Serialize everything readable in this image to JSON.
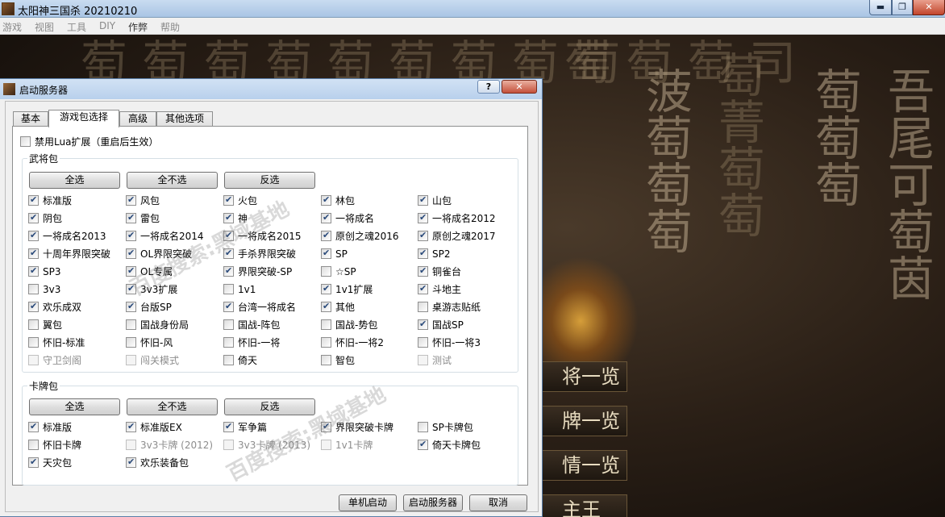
{
  "window": {
    "title": "太阳神三国杀 20210210",
    "controls": {
      "minimize": "▬",
      "maximize": "❐",
      "close": "✕"
    }
  },
  "menu": [
    "游戏",
    "视图",
    "工具",
    "DIY",
    "作弊",
    "帮助"
  ],
  "background": {
    "lobby_buttons": [
      "将一览",
      "牌一览",
      "情一览",
      "主王"
    ]
  },
  "dialog": {
    "title": "启动服务器",
    "help": "?",
    "close": "✕",
    "tabs": [
      "基本",
      "游戏包选择",
      "高级",
      "其他选项"
    ],
    "active_tab": "游戏包选择",
    "disable_lua": {
      "label": "禁用Lua扩展（重启后生效）",
      "checked": false
    },
    "general_group": {
      "title": "武将包",
      "buttons": [
        "全选",
        "全不选",
        "反选"
      ],
      "items": [
        {
          "label": "标准版",
          "checked": true,
          "disabled": false
        },
        {
          "label": "风包",
          "checked": true,
          "disabled": false
        },
        {
          "label": "火包",
          "checked": true,
          "disabled": false
        },
        {
          "label": "林包",
          "checked": true,
          "disabled": false
        },
        {
          "label": "山包",
          "checked": true,
          "disabled": false
        },
        {
          "label": "阴包",
          "checked": true,
          "disabled": false
        },
        {
          "label": "雷包",
          "checked": true,
          "disabled": false
        },
        {
          "label": "神",
          "checked": true,
          "disabled": false
        },
        {
          "label": "一将成名",
          "checked": true,
          "disabled": false
        },
        {
          "label": "一将成名2012",
          "checked": true,
          "disabled": false
        },
        {
          "label": "一将成名2013",
          "checked": true,
          "disabled": false
        },
        {
          "label": "一将成名2014",
          "checked": true,
          "disabled": false
        },
        {
          "label": "一将成名2015",
          "checked": true,
          "disabled": false
        },
        {
          "label": "原创之魂2016",
          "checked": true,
          "disabled": false
        },
        {
          "label": "原创之魂2017",
          "checked": true,
          "disabled": false
        },
        {
          "label": "十周年界限突破",
          "checked": true,
          "disabled": false
        },
        {
          "label": "OL界限突破",
          "checked": true,
          "disabled": false
        },
        {
          "label": "手杀界限突破",
          "checked": true,
          "disabled": false
        },
        {
          "label": "SP",
          "checked": true,
          "disabled": false
        },
        {
          "label": "SP2",
          "checked": true,
          "disabled": false
        },
        {
          "label": "SP3",
          "checked": true,
          "disabled": false
        },
        {
          "label": "OL专属",
          "checked": true,
          "disabled": false
        },
        {
          "label": "界限突破-SP",
          "checked": true,
          "disabled": false
        },
        {
          "label": "☆SP",
          "checked": false,
          "disabled": false
        },
        {
          "label": "铜雀台",
          "checked": true,
          "disabled": false
        },
        {
          "label": "3v3",
          "checked": false,
          "disabled": false
        },
        {
          "label": "3v3扩展",
          "checked": true,
          "disabled": false
        },
        {
          "label": "1v1",
          "checked": false,
          "disabled": false
        },
        {
          "label": "1v1扩展",
          "checked": true,
          "disabled": false
        },
        {
          "label": "斗地主",
          "checked": true,
          "disabled": false
        },
        {
          "label": "欢乐成双",
          "checked": true,
          "disabled": false
        },
        {
          "label": "台版SP",
          "checked": true,
          "disabled": false
        },
        {
          "label": "台湾一将成名",
          "checked": true,
          "disabled": false
        },
        {
          "label": "其他",
          "checked": true,
          "disabled": false
        },
        {
          "label": "桌游志贴纸",
          "checked": false,
          "disabled": false
        },
        {
          "label": "翼包",
          "checked": false,
          "disabled": false
        },
        {
          "label": "国战身份局",
          "checked": false,
          "disabled": false
        },
        {
          "label": "国战-阵包",
          "checked": false,
          "disabled": false
        },
        {
          "label": "国战-势包",
          "checked": false,
          "disabled": false
        },
        {
          "label": "国战SP",
          "checked": true,
          "disabled": false
        },
        {
          "label": "怀旧-标准",
          "checked": false,
          "disabled": false
        },
        {
          "label": "怀旧-风",
          "checked": false,
          "disabled": false
        },
        {
          "label": "怀旧-一将",
          "checked": false,
          "disabled": false
        },
        {
          "label": "怀旧-一将2",
          "checked": false,
          "disabled": false
        },
        {
          "label": "怀旧-一将3",
          "checked": false,
          "disabled": false
        },
        {
          "label": "守卫剑阁",
          "checked": false,
          "disabled": true
        },
        {
          "label": "闯关模式",
          "checked": false,
          "disabled": true
        },
        {
          "label": "倚天",
          "checked": false,
          "disabled": false
        },
        {
          "label": "智包",
          "checked": false,
          "disabled": false
        },
        {
          "label": "测试",
          "checked": false,
          "disabled": true
        }
      ]
    },
    "card_group": {
      "title": "卡牌包",
      "buttons": [
        "全选",
        "全不选",
        "反选"
      ],
      "items": [
        {
          "label": "标准版",
          "checked": true,
          "disabled": false
        },
        {
          "label": "标准版EX",
          "checked": true,
          "disabled": false
        },
        {
          "label": "军争篇",
          "checked": true,
          "disabled": false
        },
        {
          "label": "界限突破卡牌",
          "checked": true,
          "disabled": false
        },
        {
          "label": "SP卡牌包",
          "checked": false,
          "disabled": false
        },
        {
          "label": "怀旧卡牌",
          "checked": false,
          "disabled": false
        },
        {
          "label": "3v3卡牌 (2012)",
          "checked": false,
          "disabled": true
        },
        {
          "label": "3v3卡牌 (2013)",
          "checked": false,
          "disabled": true
        },
        {
          "label": "1v1卡牌",
          "checked": false,
          "disabled": true
        },
        {
          "label": "倚天卡牌包",
          "checked": true,
          "disabled": false
        },
        {
          "label": "天灾包",
          "checked": true,
          "disabled": false
        },
        {
          "label": "欢乐装备包",
          "checked": true,
          "disabled": false
        }
      ]
    },
    "footer_buttons": [
      "单机启动",
      "启动服务器",
      "取消"
    ],
    "watermark": "百度搜索:黑域基地"
  }
}
